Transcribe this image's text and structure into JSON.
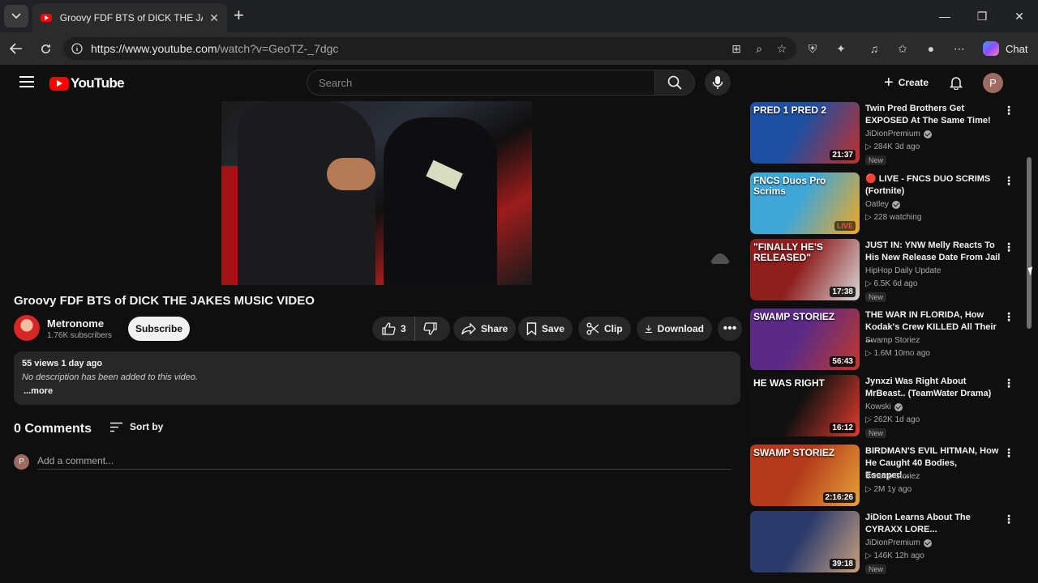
{
  "browser": {
    "tab_title": "Groovy FDF BTS of DICK THE JAKES",
    "url_host": "https://www.youtube.com",
    "url_path": "/watch?v=GeoTZ-_7dgc",
    "chat_label": "Chat"
  },
  "header": {
    "logo_text": "YouTube",
    "search_placeholder": "Search",
    "create_label": "Create",
    "avatar_initial": "P"
  },
  "video": {
    "title": "Groovy FDF BTS of DICK THE JAKES MUSIC VIDEO",
    "channel_name": "Metronome",
    "channel_subs": "1.76K subscribers",
    "subscribe_label": "Subscribe",
    "like_count": "3",
    "share_label": "Share",
    "save_label": "Save",
    "clip_label": "Clip",
    "download_label": "Download"
  },
  "description": {
    "meta": "55 views  1 day ago",
    "text": "No description has been added to this video.",
    "more": "...more"
  },
  "comments": {
    "title": "0 Comments",
    "sort_label": "Sort by",
    "user_initial": "P",
    "placeholder": "Add a comment..."
  },
  "recommendations": [
    {
      "title": "Twin Pred Brothers Get EXPOSED At The Same Time!",
      "channel": "JiDionPremium",
      "verified": true,
      "stats": "▷ 284K  3d ago",
      "duration": "21:37",
      "new": "New",
      "thumb_text": "PRED 1  PRED 2",
      "colors": [
        "#1f4fa0",
        "#c3302a"
      ]
    },
    {
      "title": "🔴 LIVE - FNCS DUO SCRIMS (Fortnite)",
      "channel": "Oatley",
      "verified": true,
      "stats": "▷ 228 watching",
      "live": "LIVE",
      "thumb_text": "FNCS Duos Pro Scrims",
      "colors": [
        "#3fa7d8",
        "#f2a81d"
      ]
    },
    {
      "title": "JUST IN: YNW Melly Reacts To His New Release Date From Jail",
      "channel": "HipHop Daily Update",
      "verified": false,
      "stats": "▷ 6.5K  6d ago",
      "duration": "17:38",
      "new": "New",
      "thumb_text": "\"FINALLY HE'S RELEASED\"",
      "colors": [
        "#8f1e1e",
        "#d9d9d9"
      ]
    },
    {
      "title": "THE WAR IN FLORIDA, How Kodak's Crew KILLED All Their ...",
      "channel": "Swamp Storiez",
      "verified": false,
      "stats": "▷ 1.6M  10mo ago",
      "duration": "56:43",
      "thumb_text": "SWAMP STORIEZ",
      "colors": [
        "#5b2a86",
        "#c0392b"
      ]
    },
    {
      "title": "Jynxzi Was Right About MrBeast.. (TeamWater Drama)",
      "channel": "Kowski",
      "verified": true,
      "stats": "▷ 262K  1d ago",
      "duration": "16:12",
      "new": "New",
      "thumb_text": "HE WAS RIGHT",
      "colors": [
        "#111111",
        "#e23b2e"
      ]
    },
    {
      "title": "BIRDMAN'S EVIL HITMAN, How He Caught 40 Bodies, Escaped...",
      "channel": "Swamp Storiez",
      "verified": false,
      "stats": "▷ 2M  1y ago",
      "duration": "2:16:26",
      "thumb_text": "SWAMP STORIEZ",
      "colors": [
        "#b33a1a",
        "#e8a23a"
      ]
    },
    {
      "title": "JiDion Learns About The CYRAXX LORE...",
      "channel": "JiDionPremium",
      "verified": true,
      "stats": "▷ 146K  12h ago",
      "duration": "39:18",
      "new": "New",
      "thumb_text": "",
      "colors": [
        "#2a3a6a",
        "#c8a080"
      ]
    }
  ]
}
